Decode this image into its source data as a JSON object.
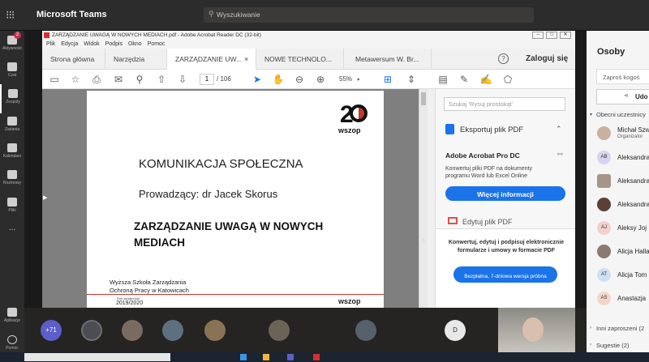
{
  "app": {
    "title": "Microsoft Teams",
    "search_placeholder": "Wyszukiwanie"
  },
  "rail": [
    {
      "label": "Aktywność",
      "badge": "2"
    },
    {
      "label": "Czat"
    },
    {
      "label": "Zespoły"
    },
    {
      "label": "Zadania"
    },
    {
      "label": "Kalendarz"
    },
    {
      "label": "Rozmowy"
    },
    {
      "label": "Pliki"
    },
    {
      "label": "..."
    },
    {
      "label": "Aplikacje"
    },
    {
      "label": "Pomoc"
    }
  ],
  "acrobat": {
    "window_title": "ZARZĄDZANIE UWAGĄ W NOWYCH MEDIACH.pdf - Adobe Acrobat Reader DC (32-bit)",
    "menu": [
      "Plik",
      "Edycja",
      "Widok",
      "Podpis",
      "Okno",
      "Pomoc"
    ],
    "tabs": [
      "Strona główna",
      "Narzędzia",
      "ZARZĄDZANIE UW...",
      "NOWE TECHNOLO...",
      "Metawersum W. Br..."
    ],
    "tab_close": "×",
    "login": "Zaloguj się",
    "help": "?",
    "page_current": "1",
    "page_total": "/ 106",
    "zoom": "55%",
    "sidebar": {
      "search_placeholder": "Szukaj 'Rysuj prostokąt'",
      "export_label": "Eksportuj plik PDF",
      "pro_title": "Adobe Acrobat Pro DC",
      "pro_desc": "Konwertuj pliki PDF na dokumenty programu Word lub Excel Online",
      "more_info": "Więcej informacji",
      "edit_label": "Edytuj plik PDF",
      "promo_text": "Konwertuj, edytuj i podpisuj elektronicznie formularze i umowy w formacie PDF",
      "trial_button": "Bezpłatna, 7-dniowa wersja próbna"
    }
  },
  "slide": {
    "logo_text": "wszop",
    "title": "KOMUNIKACJA SPOŁECZNA",
    "lecturer": "Prowadzący: dr Jacek Skorus",
    "subject_line1": "ZARZĄDZANIE UWAGĄ W NOWYCH",
    "subject_line2": "MEDIACH",
    "school_line1": "Wyższa Szkoła Zarządzania",
    "school_line2": "Ochroną Pracy w Katowicach",
    "year_label": "Rok akademicki",
    "year": "2019/2020",
    "footer_logo": "wszop"
  },
  "participants_strip": {
    "overflow": "+71",
    "avatar_initial": "D"
  },
  "people": {
    "title": "Osoby",
    "invite": "Zaproś kogoś",
    "share": "Udo",
    "section_current": "Obecni uczestnicy",
    "items": [
      {
        "name": "Michał Szw",
        "sub": "Organizator",
        "initials": ""
      },
      {
        "name": "Aleksandra",
        "initials": "AB"
      },
      {
        "name": "Aleksandra",
        "initials": ""
      },
      {
        "name": "Aleksandra",
        "initials": ""
      },
      {
        "name": "Aleksy Joj",
        "initials": "AJ"
      },
      {
        "name": "Alicja Halla",
        "initials": ""
      },
      {
        "name": "Alicja Tom",
        "initials": "AT"
      },
      {
        "name": "Anastazja",
        "initials": "AS"
      }
    ],
    "invited": "Inni zaproszeni (2",
    "suggestions": "Sugestie (2)"
  },
  "colors": {
    "accent": "#1a73e8",
    "teams_dark": "#2d2c2c",
    "slide_red": "#c0392b"
  }
}
